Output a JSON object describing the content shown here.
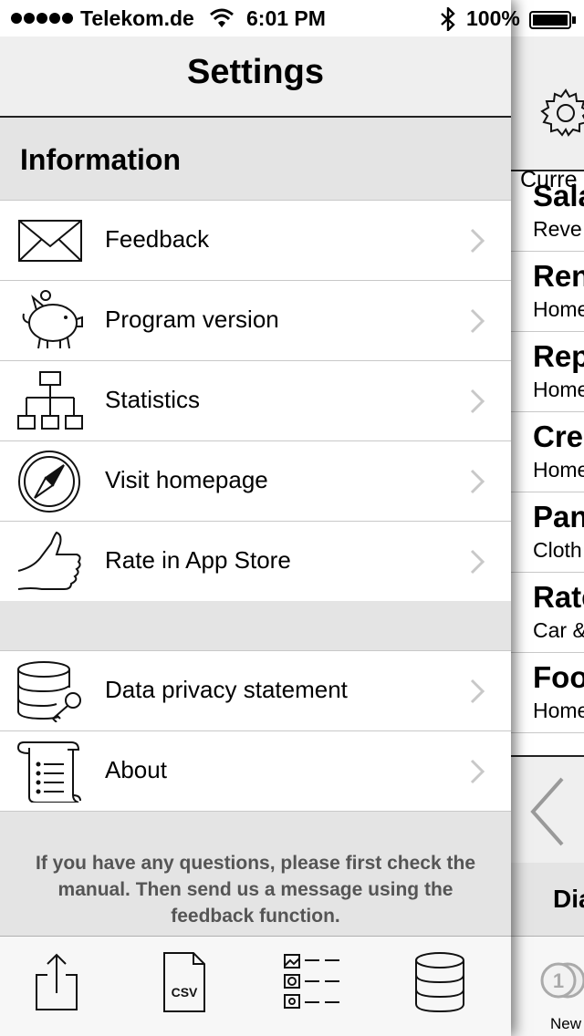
{
  "status_bar": {
    "carrier": "Telekom.de",
    "time": "6:01 PM",
    "battery": "100%",
    "signal_icon": "signal-dots-icon",
    "wifi_icon": "wifi-icon",
    "bluetooth_icon": "bluetooth-icon",
    "battery_icon": "battery-icon"
  },
  "nav": {
    "title": "Settings"
  },
  "section": {
    "title": "Information"
  },
  "items": [
    {
      "label": "Feedback",
      "icon": "envelope-icon"
    },
    {
      "label": "Program version",
      "icon": "piggy-bank-icon"
    },
    {
      "label": "Statistics",
      "icon": "hierarchy-chart-icon"
    },
    {
      "label": "Visit homepage",
      "icon": "compass-icon"
    },
    {
      "label": "Rate in App Store",
      "icon": "thumbs-up-icon"
    },
    {
      "label": "Data privacy statement",
      "icon": "database-key-icon"
    },
    {
      "label": "About",
      "icon": "scroll-icon"
    }
  ],
  "footer": {
    "text": "If you have any questions, please first check the manual. Then send us a message using the feedback function."
  },
  "tabbar": [
    {
      "icon": "share-export-icon"
    },
    {
      "icon": "csv-file-icon",
      "badge": "CSV"
    },
    {
      "icon": "category-list-icon"
    },
    {
      "icon": "database-icon"
    }
  ],
  "behind": {
    "header_text": "Curre",
    "rows": [
      {
        "title": "Sala",
        "subtitle": "Reve"
      },
      {
        "title": "Ren",
        "subtitle": "Home"
      },
      {
        "title": "Rep",
        "subtitle": "Home"
      },
      {
        "title": "Cre",
        "subtitle": "Home"
      },
      {
        "title": "Pan",
        "subtitle": "Cloth"
      },
      {
        "title": "Rate",
        "subtitle": "Car &"
      },
      {
        "title": "Foo",
        "subtitle": "Home"
      }
    ],
    "diagram_label": "Dia",
    "tab_label": "New",
    "coin_badge": "1"
  },
  "colors": {
    "background": "#efefef",
    "section": "#e4e4e4",
    "separator": "#c8c8c8",
    "chevron": "#c8c8c8",
    "footer_text": "#555555"
  }
}
